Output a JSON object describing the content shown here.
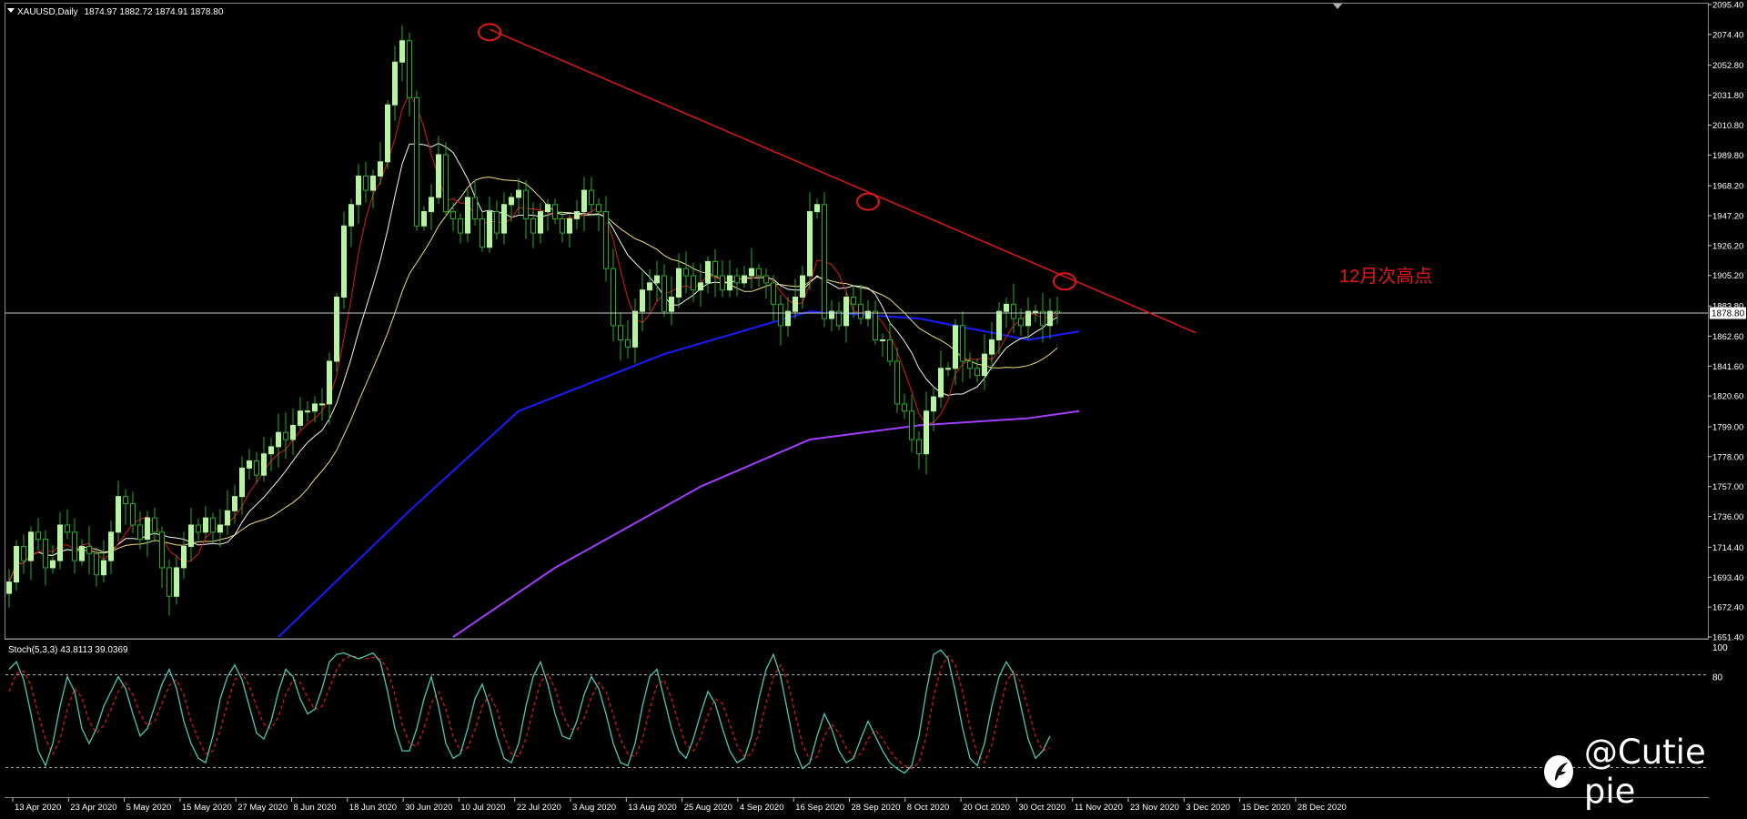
{
  "symbol_header": {
    "symbol": "XAUUSD,Daily",
    "ohlc": "1874.97 1882.72 1874.91 1878.80"
  },
  "osc_header": {
    "label": "Stoch(5,3,3) 43.8113 39.0369"
  },
  "annotation": {
    "text": "12月次高点"
  },
  "watermark": {
    "text": "@Cutie pie"
  },
  "colors": {
    "background": "#000000",
    "bull_candle": "#b6f4a0",
    "bear_candle": "#20b020",
    "ma_red": "#e01818",
    "ma_white": "#f5f5f5",
    "ma_yellow": "#f0dc82",
    "ma_blue": "#1a1cff",
    "ma_purple": "#a33dff",
    "trendline": "#e01818",
    "stoch_main": "#4ec9b0",
    "stoch_signal": "#e01818"
  },
  "chart_data": [
    {
      "type": "candlestick",
      "title": "XAUUSD,Daily",
      "current_price": 1878.8,
      "ylim": [
        1651.4,
        2095.4
      ],
      "y_ticks": [
        "2095.40",
        "2074.40",
        "2052.80",
        "2031.80",
        "2010.80",
        "1989.80",
        "1968.20",
        "1947.20",
        "1926.20",
        "1905.20",
        "1883.80",
        "1862.60",
        "1841.60",
        "1820.60",
        "1799.00",
        "1778.00",
        "1757.00",
        "1736.00",
        "1714.40",
        "1693.40",
        "1672.40",
        "1651.40"
      ],
      "x_ticks": [
        "13 Apr 2020",
        "23 Apr 2020",
        "5 May 2020",
        "15 May 2020",
        "27 May 2020",
        "8 Jun 2020",
        "18 Jun 2020",
        "30 Jun 2020",
        "10 Jul 2020",
        "22 Jul 2020",
        "3 Aug 2020",
        "13 Aug 2020",
        "25 Aug 2020",
        "4 Sep 2020",
        "16 Sep 2020",
        "28 Sep 2020",
        "8 Oct 2020",
        "20 Oct 2020",
        "30 Oct 2020",
        "11 Nov 2020",
        "23 Nov 2020",
        "3 Dec 2020",
        "15 Dec 2020",
        "28 Dec 2020"
      ],
      "close_path": [
        1690,
        1715,
        1705,
        1725,
        1720,
        1700,
        1705,
        1730,
        1725,
        1705,
        1715,
        1710,
        1695,
        1705,
        1725,
        1750,
        1745,
        1730,
        1720,
        1735,
        1725,
        1700,
        1680,
        1700,
        1715,
        1730,
        1725,
        1735,
        1725,
        1730,
        1740,
        1750,
        1770,
        1775,
        1765,
        1780,
        1785,
        1795,
        1790,
        1800,
        1810,
        1810,
        1815,
        1815,
        1845,
        1890,
        1940,
        1955,
        1975,
        1965,
        1975,
        1985,
        2025,
        2055,
        2070,
        2030,
        1940,
        1950,
        1960,
        1990,
        1950,
        1945,
        1935,
        1960,
        1945,
        1925,
        1950,
        1935,
        1955,
        1960,
        1965,
        1945,
        1935,
        1950,
        1955,
        1945,
        1935,
        1945,
        1950,
        1965,
        1955,
        1950,
        1910,
        1870,
        1860,
        1855,
        1880,
        1895,
        1900,
        1905,
        1880,
        1890,
        1910,
        1905,
        1895,
        1900,
        1915,
        1905,
        1895,
        1905,
        1900,
        1905,
        1910,
        1905,
        1900,
        1885,
        1870,
        1880,
        1890,
        1905,
        1950,
        1955,
        1875,
        1880,
        1870,
        1890,
        1885,
        1875,
        1880,
        1860,
        1860,
        1845,
        1815,
        1810,
        1790,
        1780,
        1810,
        1820,
        1840,
        1840,
        1870,
        1845,
        1840,
        1835,
        1850,
        1860,
        1880,
        1885,
        1875,
        1870,
        1880,
        1880,
        1870,
        1880,
        1878.8
      ],
      "series": [
        {
          "name": "MA-red",
          "color": "#e01818"
        },
        {
          "name": "MA-white",
          "color": "#f5f5f5"
        },
        {
          "name": "MA-yellow",
          "color": "#f0dc82"
        },
        {
          "name": "MA-blue",
          "color": "#1a1cff"
        },
        {
          "name": "MA-purple",
          "color": "#a33dff"
        }
      ],
      "ma_blue": {
        "x_index": [
          37,
          55,
          70,
          90,
          110,
          125,
          140,
          147
        ],
        "values": [
          1651.4,
          1740,
          1810,
          1850,
          1880,
          1875,
          1860,
          1866
        ]
      },
      "ma_purple": {
        "x_index": [
          61,
          75,
          95,
          110,
          125,
          140,
          147
        ],
        "values": [
          1651.4,
          1700,
          1757,
          1790,
          1800,
          1805,
          1810
        ]
      },
      "trendline": {
        "from": {
          "x_index": 66,
          "value": 2078
        },
        "to": {
          "x_index": 163,
          "value": 1865
        }
      },
      "marked_highs": [
        {
          "x_index": 66,
          "value": 2076
        },
        {
          "x_index": 118,
          "value": 1957
        },
        {
          "x_index": 145,
          "value": 1901
        }
      ]
    },
    {
      "type": "line",
      "title": "Stoch(5,3,3) 43.8113 39.0369",
      "ylim": [
        0,
        100
      ],
      "y_ticks": [
        "100",
        "80"
      ],
      "levels": [
        80,
        20
      ],
      "main": [
        85,
        90,
        78,
        55,
        30,
        20,
        35,
        60,
        80,
        70,
        45,
        35,
        45,
        60,
        70,
        80,
        72,
        55,
        40,
        45,
        60,
        75,
        85,
        72,
        50,
        35,
        25,
        22,
        40,
        65,
        80,
        88,
        78,
        60,
        42,
        38,
        50,
        70,
        85,
        80,
        65,
        55,
        58,
        72,
        90,
        95,
        96,
        94,
        92,
        94,
        96,
        90,
        70,
        45,
        30,
        30,
        45,
        65,
        80,
        60,
        35,
        25,
        28,
        45,
        65,
        75,
        60,
        40,
        25,
        22,
        35,
        60,
        80,
        90,
        75,
        55,
        40,
        38,
        50,
        68,
        80,
        72,
        55,
        35,
        22,
        20,
        35,
        60,
        80,
        85,
        65,
        45,
        30,
        25,
        38,
        55,
        70,
        62,
        45,
        30,
        22,
        25,
        40,
        65,
        85,
        95,
        80,
        55,
        30,
        18,
        22,
        40,
        55,
        45,
        30,
        22,
        25,
        38,
        50,
        40,
        30,
        22,
        18,
        15,
        20,
        40,
        70,
        95,
        98,
        92,
        70,
        45,
        25,
        20,
        35,
        60,
        80,
        90,
        82,
        60,
        38,
        25,
        30,
        40
      ],
      "signal": [
        70,
        82,
        84,
        74,
        55,
        38,
        28,
        38,
        58,
        72,
        66,
        50,
        42,
        47,
        58,
        70,
        76,
        68,
        55,
        47,
        50,
        62,
        74,
        78,
        68,
        50,
        38,
        28,
        30,
        44,
        62,
        78,
        82,
        74,
        60,
        48,
        45,
        53,
        68,
        78,
        76,
        66,
        58,
        60,
        72,
        85,
        92,
        94,
        93,
        92,
        93,
        92,
        85,
        68,
        48,
        35,
        33,
        45,
        62,
        70,
        58,
        40,
        30,
        32,
        44,
        60,
        68,
        58,
        40,
        28,
        26,
        38,
        58,
        76,
        82,
        72,
        55,
        45,
        44,
        52,
        66,
        76,
        70,
        54,
        38,
        28,
        26,
        38,
        58,
        74,
        78,
        65,
        48,
        34,
        30,
        39,
        54,
        65,
        62,
        48,
        34,
        26,
        28,
        42,
        62,
        80,
        88,
        76,
        55,
        34,
        24,
        26,
        40,
        48,
        42,
        32,
        26,
        28,
        38,
        44,
        38,
        30,
        24,
        20,
        18,
        22,
        40,
        66,
        86,
        94,
        88,
        70,
        46,
        28,
        22,
        34,
        56,
        76,
        84,
        76,
        58,
        40,
        30,
        32
      ]
    }
  ]
}
